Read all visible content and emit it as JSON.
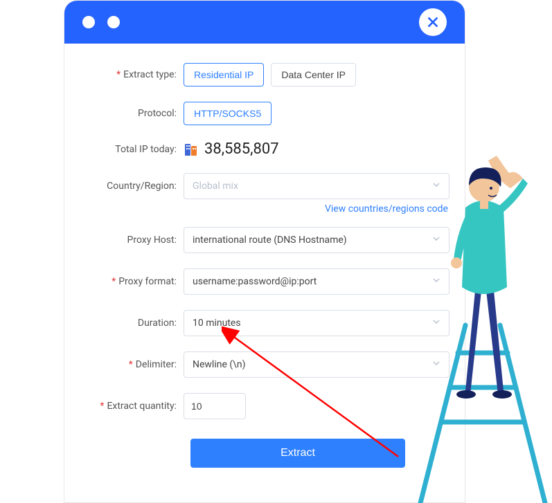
{
  "labels": {
    "extract_type": "Extract type:",
    "protocol": "Protocol:",
    "total_ip": "Total IP today:",
    "country": "Country/Region:",
    "proxy_host": "Proxy Host:",
    "proxy_format": "Proxy format:",
    "duration": "Duration:",
    "delimiter": "Delimiter:",
    "quantity": "Extract quantity:"
  },
  "extract_type_options": [
    "Residential IP",
    "Data Center IP"
  ],
  "protocol_options": [
    "HTTP/SOCKS5"
  ],
  "total_ip_today": "38,585,807",
  "country_region_value": "Global mix",
  "link_countries": "View countries/regions code",
  "proxy_host_value": "international route (DNS Hostname)",
  "proxy_format_value": "username:password@ip:port",
  "duration_value": "10 minutes",
  "delimiter_value": "Newline (\\n)",
  "quantity_value": "10",
  "extract_button": "Extract"
}
